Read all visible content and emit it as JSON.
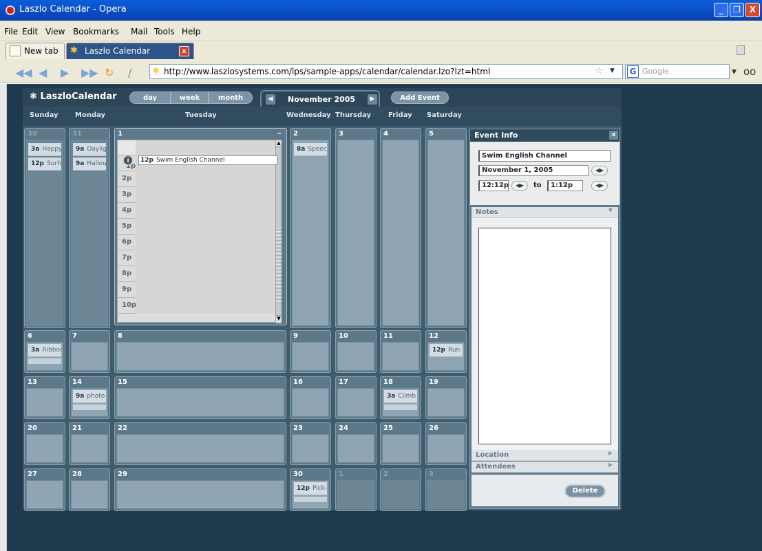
{
  "window": {
    "title": "Laszlo Calendar - Opera",
    "minimize": "_",
    "restore": "❐",
    "close": "X"
  },
  "menu": [
    "File",
    "Edit",
    "View",
    "Bookmarks",
    "Mail",
    "Tools",
    "Help"
  ],
  "tabs": [
    {
      "label": "New tab"
    },
    {
      "label": "Laszlo Calendar",
      "close": "x"
    }
  ],
  "address": {
    "url": "http://www.laszlosystems.com/lps/sample-apps/calendar/calendar.lzo?lzt=html"
  },
  "search": {
    "placeholder": "Google"
  },
  "calendar": {
    "logo": "LaszloCalendar",
    "views": [
      "day",
      "week",
      "month"
    ],
    "month_label": "November 2005",
    "add_event": "Add Event",
    "day_headers": [
      "Sunday",
      "Monday",
      "Tuesday",
      "Wednesday",
      "Thursday",
      "Friday",
      "Saturday"
    ],
    "week1": {
      "sun": {
        "num": "30",
        "events": [
          {
            "time": "3a",
            "title": "Happy"
          },
          {
            "time": "12p",
            "title": "Surfs"
          }
        ]
      },
      "mon": {
        "num": "31",
        "events": [
          {
            "time": "9a",
            "title": "Dayligi"
          },
          {
            "time": "9a",
            "title": "Hallou"
          }
        ]
      },
      "tue": {
        "num": "1"
      },
      "wed": {
        "num": "2",
        "events": [
          {
            "time": "8a",
            "title": "Speec"
          }
        ]
      },
      "thu": {
        "num": "3"
      },
      "fri": {
        "num": "4"
      },
      "sat": {
        "num": "5"
      }
    },
    "day_view": {
      "event_time": "12p",
      "event_title": "Swim English Channel",
      "info_mark": "i",
      "hours": [
        "1p",
        "2p",
        "3p",
        "4p",
        "5p",
        "6p",
        "7p",
        "8p",
        "9p",
        "10p"
      ]
    },
    "week2": {
      "nums": [
        "6",
        "7",
        "8",
        "9",
        "10",
        "11",
        "12"
      ],
      "sun_event": {
        "time": "3a",
        "title": "Ribbor"
      },
      "sat_event": {
        "time": "12p",
        "title": "Run H"
      }
    },
    "week3": {
      "nums": [
        "13",
        "14",
        "15",
        "16",
        "17",
        "18",
        "19"
      ],
      "mon_event": {
        "time": "9a",
        "title": "photo"
      },
      "fri_event": {
        "time": "3a",
        "title": "Climb"
      }
    },
    "week4": {
      "nums": [
        "20",
        "21",
        "22",
        "23",
        "24",
        "25",
        "26"
      ]
    },
    "week5": {
      "nums": [
        "27",
        "28",
        "29",
        "30",
        "1",
        "2",
        "3"
      ],
      "wed_event": {
        "time": "12p",
        "title": "Pick-u"
      }
    }
  },
  "event_info": {
    "header": "Event Info",
    "close": "x",
    "title": "Swim English Channel",
    "date": "November 1, 2005",
    "start": "12:12p",
    "to": "to",
    "end": "1:12p",
    "notes_label": "Notes",
    "location_label": "Location",
    "attendees_label": "Attendees",
    "delete": "Delete"
  }
}
